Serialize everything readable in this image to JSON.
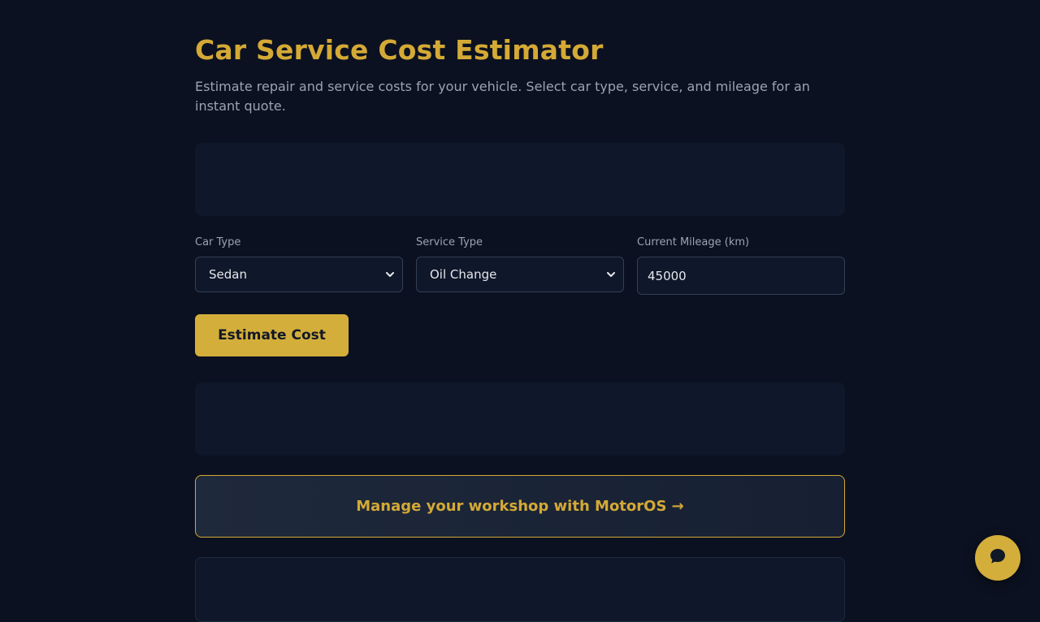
{
  "header": {
    "title": "Car Service Cost Estimator",
    "subtitle": "Estimate repair and service costs for your vehicle. Select car type, service, and mileage for an instant quote."
  },
  "form": {
    "car_type": {
      "label": "Car Type",
      "selected": "Sedan"
    },
    "service_type": {
      "label": "Service Type",
      "selected": "Oil Change"
    },
    "mileage": {
      "label": "Current Mileage (km)",
      "value": "45000"
    },
    "submit_label": "Estimate Cost"
  },
  "promo": {
    "text": "Manage your workshop with MotorOS →"
  },
  "icons": {
    "chat": "chat-bubble-icon",
    "dropdown": "chevron-down-icon"
  },
  "colors": {
    "background": "#0b1120",
    "accent": "#d4a935",
    "card": "#0f172a",
    "muted_text": "#9ca3af"
  }
}
